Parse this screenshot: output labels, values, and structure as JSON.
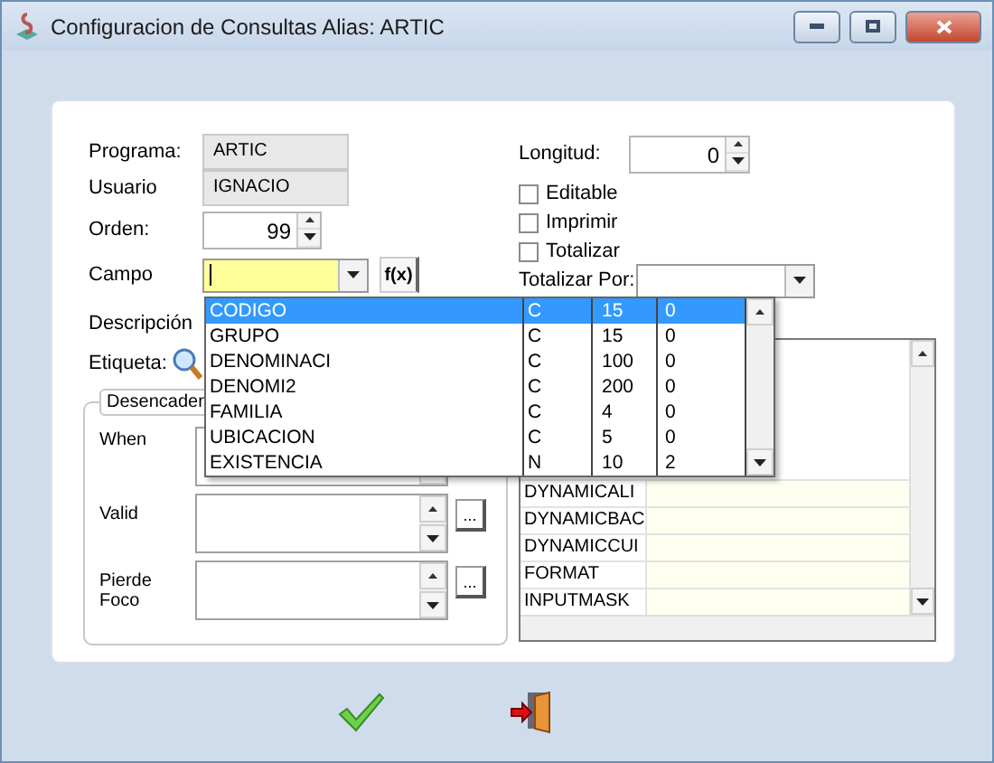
{
  "window": {
    "title": "Configuracion de Consultas Alias: ARTIC"
  },
  "form": {
    "programa": {
      "label": "Programa:",
      "value": "ARTIC"
    },
    "usuario": {
      "label": "Usuario",
      "value": "IGNACIO"
    },
    "orden": {
      "label": "Orden:",
      "value": "99"
    },
    "campo": {
      "label": "Campo",
      "button": "f(x)"
    },
    "descripcion": {
      "label": "Descripción"
    },
    "etiqueta": {
      "label": "Etiqueta:"
    }
  },
  "triggers": {
    "legend": "Desencaden",
    "fields": [
      {
        "label": "When"
      },
      {
        "label": "Valid",
        "button": "..."
      },
      {
        "label": "Pierde Foco",
        "button": "..."
      }
    ]
  },
  "right": {
    "longitud": {
      "label": "Longitud:",
      "value": "0"
    },
    "checks": [
      {
        "label": "Editable",
        "checked": false
      },
      {
        "label": "Imprimir",
        "checked": false
      },
      {
        "label": "Totalizar",
        "checked": false
      }
    ],
    "totalizar_por": {
      "label": "Totalizar Por:"
    }
  },
  "grid": {
    "rows": [
      "DYNAMICALI",
      "DYNAMICBAC",
      "DYNAMICCUI",
      "FORMAT",
      "INPUTMASK"
    ]
  },
  "dropdown": [
    {
      "name": "CODIGO",
      "type": "C",
      "length": "15",
      "decimals": "0",
      "selected": true
    },
    {
      "name": "GRUPO",
      "type": "C",
      "length": "15",
      "decimals": "0",
      "selected": false
    },
    {
      "name": "DENOMINACI",
      "type": "C",
      "length": "100",
      "decimals": "0",
      "selected": false
    },
    {
      "name": "DENOMI2",
      "type": "C",
      "length": "200",
      "decimals": "0",
      "selected": false
    },
    {
      "name": "FAMILIA",
      "type": "C",
      "length": "4",
      "decimals": "0",
      "selected": false
    },
    {
      "name": "UBICACION",
      "type": "C",
      "length": "5",
      "decimals": "0",
      "selected": false
    },
    {
      "name": "EXISTENCIA",
      "type": "N",
      "length": "10",
      "decimals": "2",
      "selected": false
    }
  ]
}
